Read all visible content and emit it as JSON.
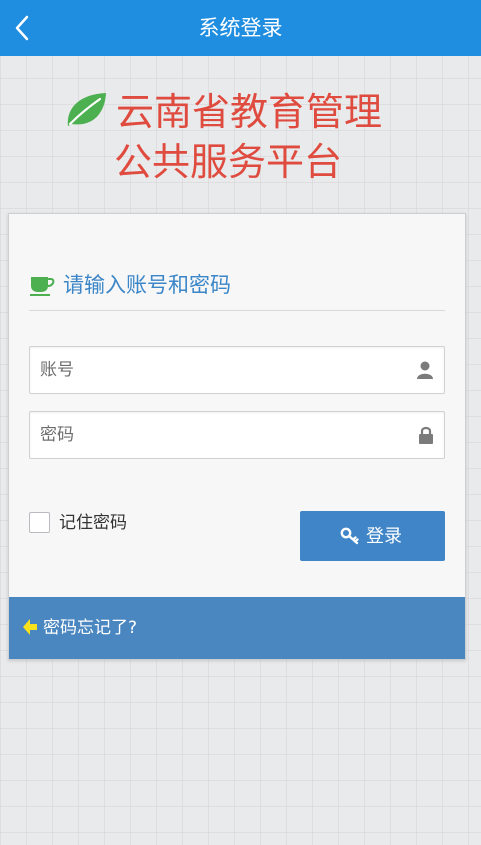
{
  "navbar": {
    "title": "系统登录",
    "back_icon": "chevron-left-icon",
    "background": "#1f8ee0"
  },
  "brand": {
    "line1": "云南省教育管理",
    "line2": "公共服务平台",
    "icon": "leaf-icon",
    "color": "#df4b3f",
    "icon_color": "#4caf50"
  },
  "login": {
    "heading": "请输入账号和密码",
    "heading_icon": "cup-icon",
    "account": {
      "placeholder": "账号",
      "value": "",
      "icon": "user-icon"
    },
    "password": {
      "placeholder": "密码",
      "value": "",
      "icon": "lock-icon"
    },
    "remember_label": "记住密码",
    "remember_checked": false,
    "submit_label": "登录",
    "submit_icon": "key-icon",
    "accent": "#3f85c7"
  },
  "footer": {
    "forgot_label": "密码忘记了?",
    "forgot_icon": "arrow-left-icon",
    "background": "#4a86c0"
  }
}
